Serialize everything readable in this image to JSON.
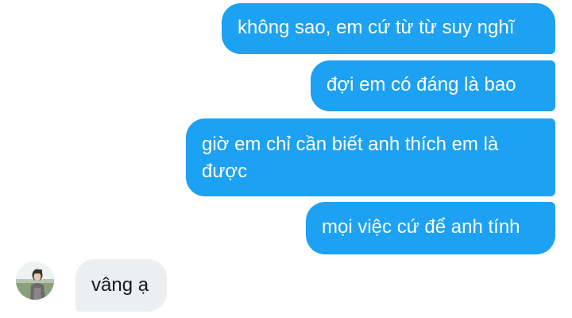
{
  "messages": {
    "m1": "không sao, em cứ từ từ suy nghĩ",
    "m2": "đợi em có đáng là bao",
    "m3": "giờ em chỉ cần biết anh thích em là được",
    "m4": "mọi việc cứ để anh tính",
    "m5": "vâng ạ"
  },
  "colors": {
    "outgoing_bubble": "#1da1f2",
    "incoming_bubble": "#eceef0"
  },
  "avatar": {
    "icon": "person-photo-icon"
  }
}
